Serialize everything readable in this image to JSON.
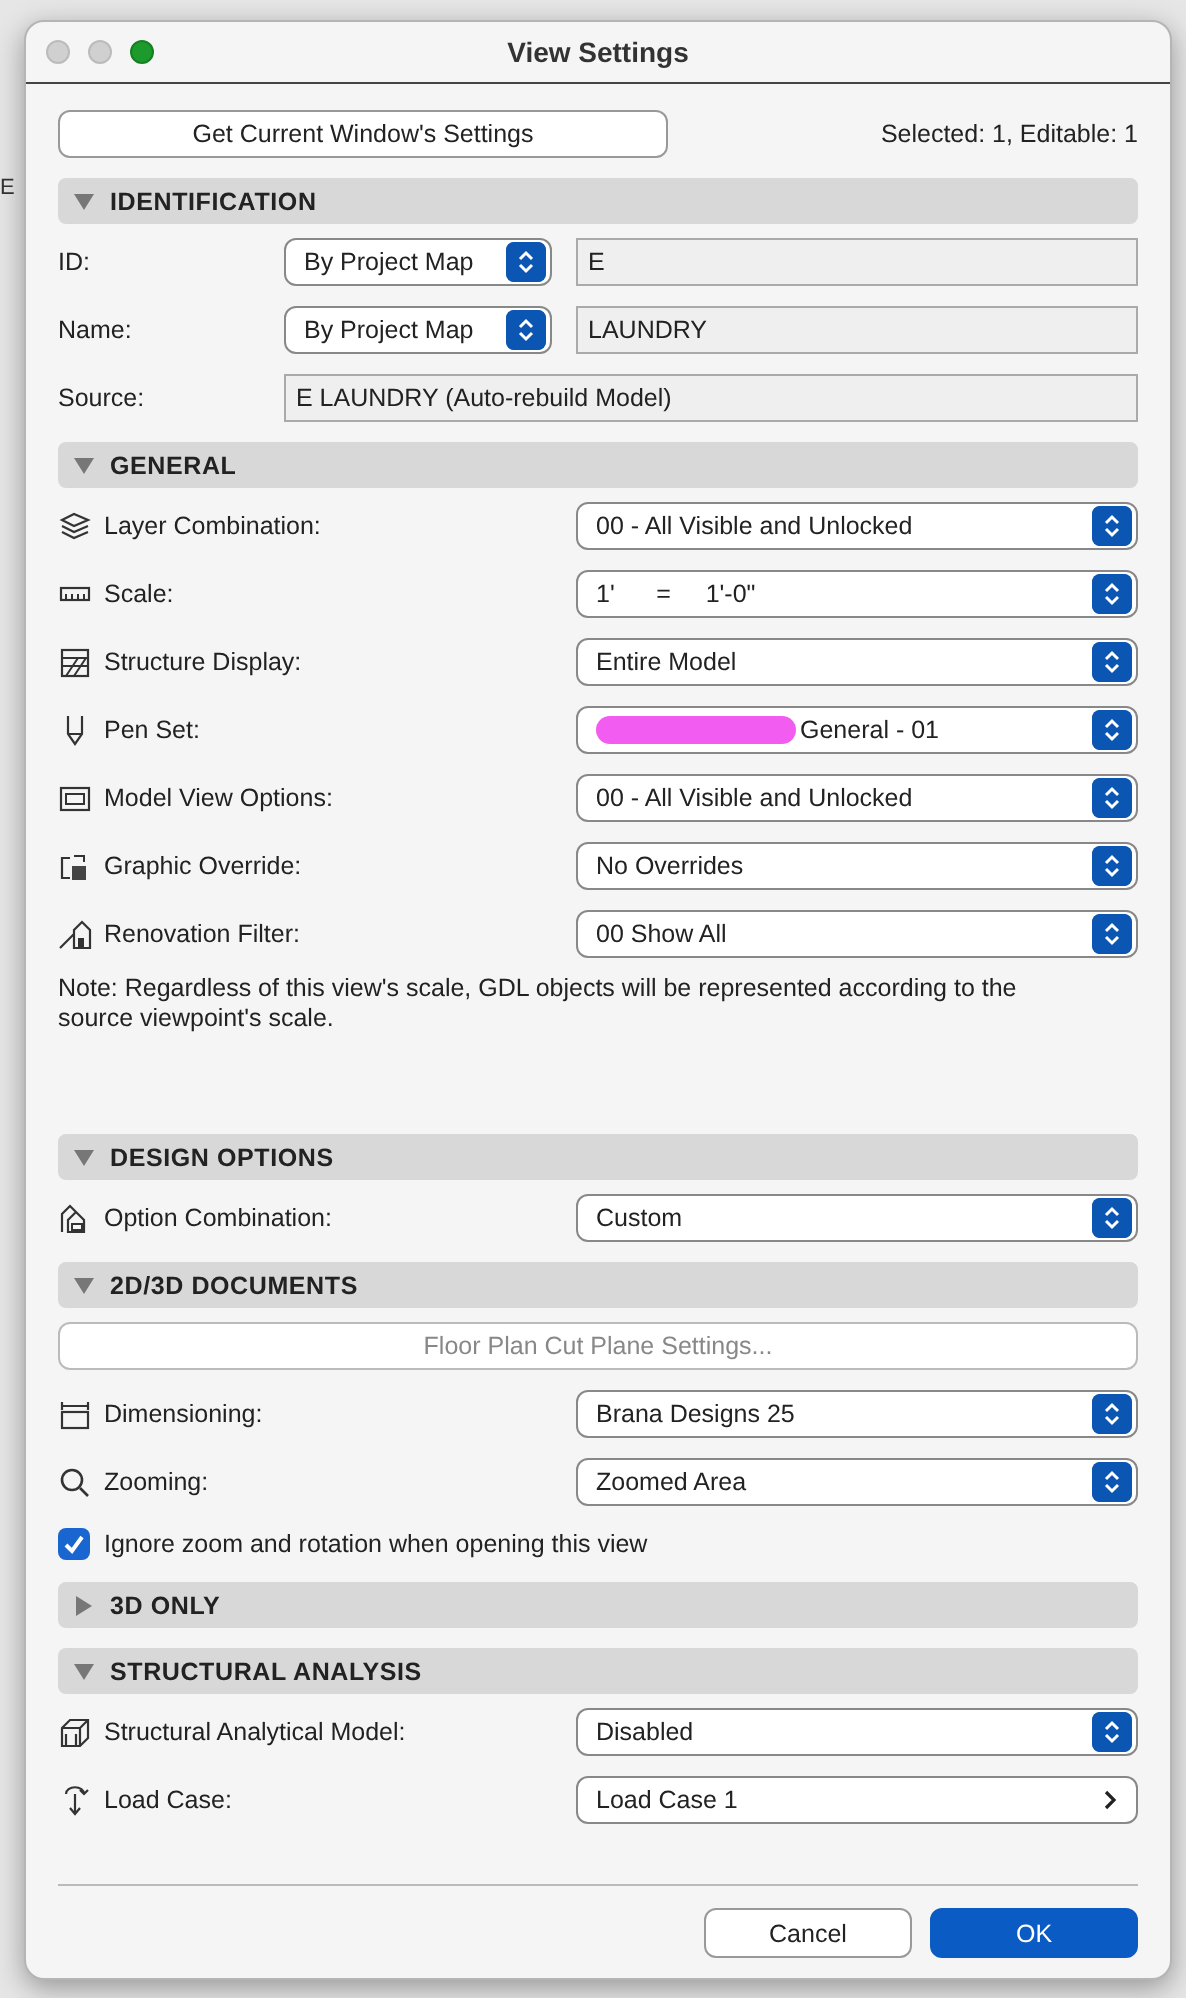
{
  "background": {
    "text": "E"
  },
  "window": {
    "title": "View Settings"
  },
  "top": {
    "button": "Get Current Window's Settings",
    "status": "Selected: 1, Editable: 1"
  },
  "sections": [
    {
      "title": "IDENTIFICATION",
      "expanded": true,
      "items": [
        {
          "kind": "row",
          "icon": false,
          "label": "ID:",
          "controls": [
            {
              "kind": "popup",
              "value": "By Project Map"
            },
            {
              "kind": "readonly",
              "value": "E"
            }
          ]
        },
        {
          "kind": "row",
          "icon": false,
          "label": "Name:",
          "controls": [
            {
              "kind": "popup",
              "value": "By Project Map"
            },
            {
              "kind": "readonly",
              "value": "LAUNDRY"
            }
          ]
        },
        {
          "kind": "row",
          "icon": false,
          "label": "Source:",
          "controls": [
            {
              "kind": "readonly",
              "value": "E LAUNDRY (Auto-rebuild Model)"
            }
          ]
        }
      ]
    },
    {
      "title": "GENERAL",
      "expanded": true,
      "items": [
        {
          "kind": "row",
          "icon": true,
          "label": "Layer Combination:",
          "controls": [
            {
              "kind": "popup",
              "value": "00 - All Visible and Unlocked"
            }
          ]
        },
        {
          "kind": "row",
          "icon": true,
          "label": "Scale:",
          "controls": [
            {
              "kind": "popup",
              "value": "1'      =     1'-0\""
            }
          ]
        },
        {
          "kind": "row",
          "icon": true,
          "label": "Structure Display:",
          "controls": [
            {
              "kind": "popup",
              "value": "Entire Model"
            }
          ]
        },
        {
          "kind": "row",
          "icon": true,
          "label": "Pen Set:",
          "controls": [
            {
              "kind": "popup",
              "value": "General - 01",
              "redacted": true
            }
          ]
        },
        {
          "kind": "row",
          "icon": true,
          "label": "Model View Options:",
          "controls": [
            {
              "kind": "popup",
              "value": "00 - All Visible and Unlocked"
            }
          ]
        },
        {
          "kind": "row",
          "icon": true,
          "label": "Graphic Override:",
          "controls": [
            {
              "kind": "popup",
              "value": "No Overrides"
            }
          ]
        },
        {
          "kind": "row",
          "icon": true,
          "label": "Renovation Filter:",
          "controls": [
            {
              "kind": "popup",
              "value": "00 Show All"
            }
          ]
        },
        {
          "kind": "note",
          "text": "Note: Regardless of this view's scale, GDL objects will be represented according to the source viewpoint's scale."
        }
      ]
    },
    {
      "title": "DESIGN OPTIONS",
      "expanded": true,
      "items": [
        {
          "kind": "row",
          "icon": true,
          "label": "Option Combination:",
          "controls": [
            {
              "kind": "popup",
              "value": "Custom"
            }
          ]
        }
      ]
    },
    {
      "title": "2D/3D DOCUMENTS",
      "expanded": true,
      "items": [
        {
          "kind": "button",
          "label": "Floor Plan Cut Plane Settings...",
          "disabled": true
        },
        {
          "kind": "row",
          "icon": true,
          "label": "Dimensioning:",
          "controls": [
            {
              "kind": "popup",
              "value": "Brana Designs 25"
            }
          ]
        },
        {
          "kind": "row",
          "icon": true,
          "label": "Zooming:",
          "controls": [
            {
              "kind": "popup",
              "value": "Zoomed Area"
            }
          ]
        },
        {
          "kind": "checkbox",
          "label": "Ignore zoom and rotation when opening this view",
          "checked": true
        }
      ]
    },
    {
      "title": "3D ONLY",
      "expanded": false
    },
    {
      "title": "STRUCTURAL ANALYSIS",
      "expanded": true,
      "items": [
        {
          "kind": "row",
          "icon": true,
          "label": "Structural Analytical Model:",
          "controls": [
            {
              "kind": "popup",
              "value": "Disabled"
            }
          ]
        },
        {
          "kind": "row",
          "icon": true,
          "label": "Load Case:",
          "controls": [
            {
              "kind": "link",
              "value": "Load Case 1"
            }
          ]
        }
      ]
    }
  ],
  "footer": {
    "buttons": [
      {
        "label": "Cancel",
        "default": false
      },
      {
        "label": "OK",
        "default": true
      }
    ]
  }
}
